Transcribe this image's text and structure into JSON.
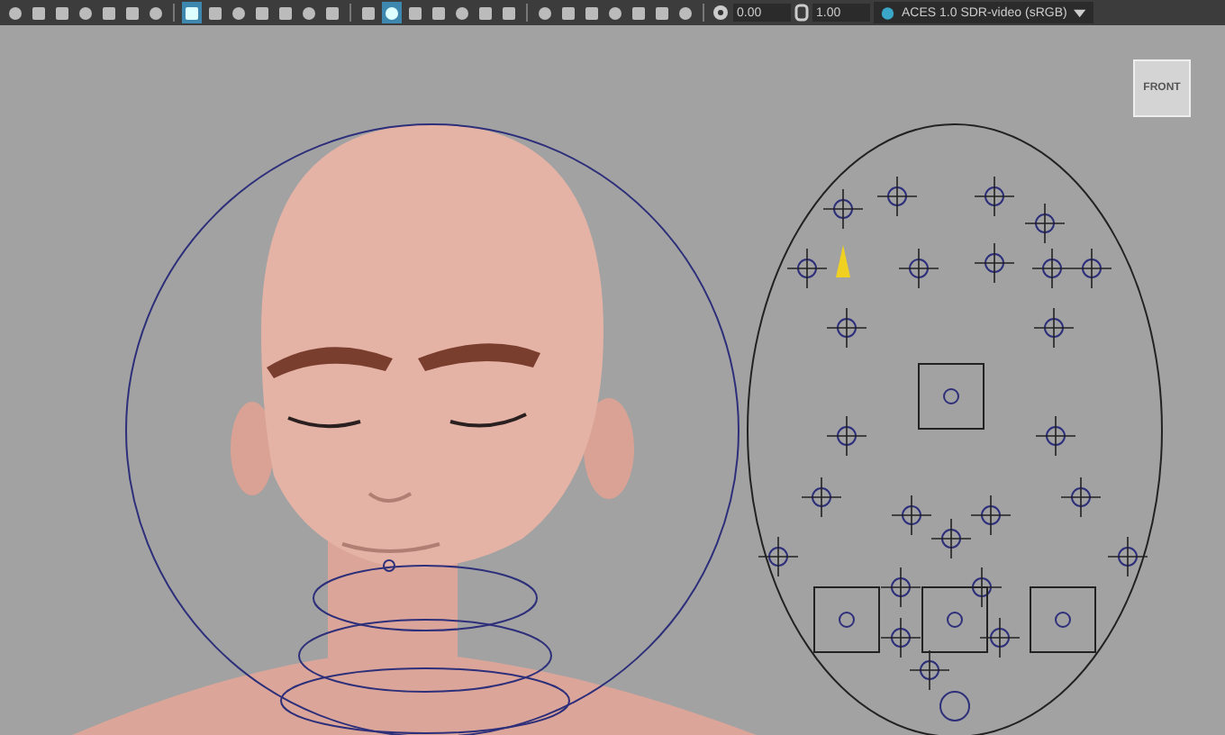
{
  "toolbar": {
    "buttons": [
      {
        "selected": false
      },
      {
        "selected": false
      },
      {
        "selected": false
      },
      {
        "selected": false
      },
      {
        "selected": false
      },
      {
        "selected": false
      },
      {
        "selected": false
      },
      {
        "selected": true
      },
      {
        "selected": false
      },
      {
        "selected": false
      },
      {
        "selected": false
      },
      {
        "selected": false
      },
      {
        "selected": false
      },
      {
        "selected": false
      },
      {
        "selected": false
      },
      {
        "selected": true
      },
      {
        "selected": false
      },
      {
        "selected": false
      },
      {
        "selected": false
      },
      {
        "selected": false
      },
      {
        "selected": false
      },
      {
        "selected": false
      },
      {
        "selected": false
      },
      {
        "selected": false
      },
      {
        "selected": false
      },
      {
        "selected": false
      },
      {
        "selected": false
      },
      {
        "selected": false
      }
    ],
    "exposure": "0.00",
    "gamma": "1.00",
    "color_space": "ACES 1.0 SDR-video (sRGB)"
  },
  "view_cube": {
    "label": "FRONT"
  }
}
